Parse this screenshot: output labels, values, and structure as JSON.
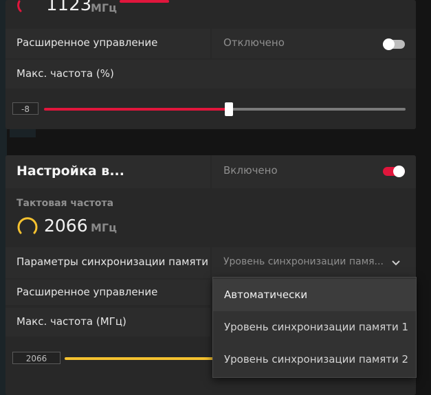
{
  "colors": {
    "accent_red": "#e0163c",
    "accent_yellow": "#f5c230",
    "panel": "#282828"
  },
  "top_card": {
    "clock_value": "1123",
    "clock_unit": "МГц",
    "advanced_control": {
      "label": "Расширенное управление",
      "value": "Отключено",
      "enabled": false
    },
    "max_freq": {
      "label": "Макс. частота (%)",
      "value": "-8",
      "slider_fraction": 0.5
    }
  },
  "vram_card": {
    "title": "Настройка в...",
    "status": "Включено",
    "enabled": true,
    "clock_label": "Тактовая частота",
    "clock_value": "2066",
    "clock_unit": "МГц",
    "memory_timing": {
      "label": "Параметры синхронизации памяти",
      "selected": "Уровень синхронизации памя...",
      "options": [
        "Автоматически",
        "Уровень синхронизации памяти 1",
        "Уровень синхронизации памяти 2"
      ],
      "highlighted": "Автоматически"
    },
    "advanced_control": {
      "label": "Расширенное управление"
    },
    "max_freq": {
      "label": "Макс. частота (МГц)",
      "value": "2066"
    }
  },
  "icons": [
    "gauge-icon",
    "chevron-down-icon"
  ]
}
